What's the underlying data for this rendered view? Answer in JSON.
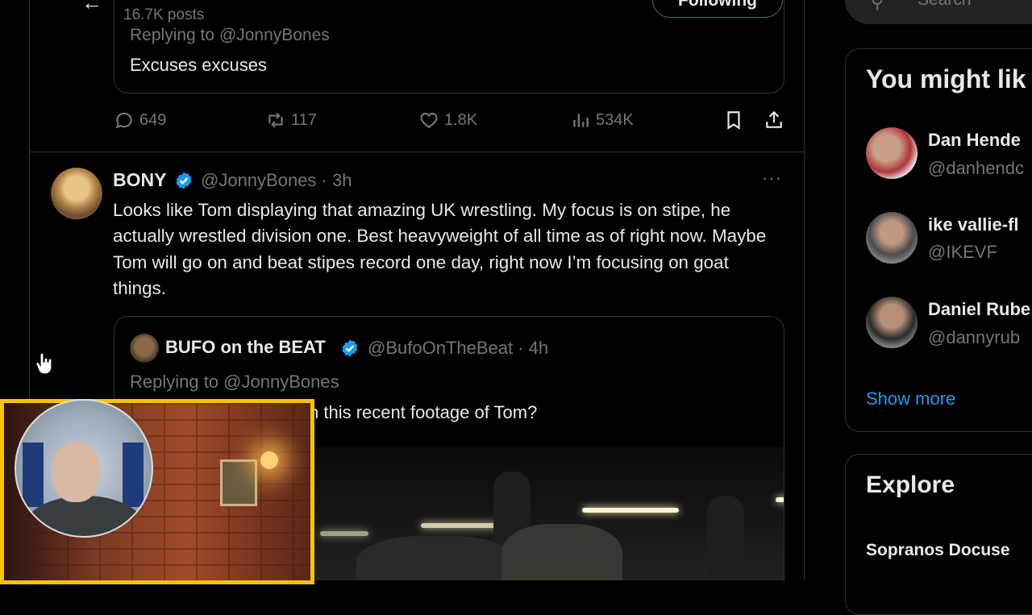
{
  "header": {
    "posts_count": "16.7K posts",
    "following_label": "Following",
    "back_glyph": "←"
  },
  "top_quote": {
    "replying_to": "Replying to @JonnyBones",
    "text": "Excuses excuses"
  },
  "actions": {
    "replies": "649",
    "reposts": "117",
    "likes": "1.8K",
    "views": "534K"
  },
  "post": {
    "name": "BONY",
    "handle_time": "@JonnyBones · 3h",
    "more": "···",
    "text": "Looks like Tom displaying that amazing UK wrestling. My focus is on stipe, he actually wrestled division one. Best heavyweight of all time as of right now. Maybe Tom will go on and beat stipes record one day, right now I’m focusing on goat things."
  },
  "quoted": {
    "name": "BUFO on the BEAT",
    "handle_time": "@BufoOnTheBeat · 4h",
    "replying_to": "Replying to @JonnyBones",
    "text_visible": "n this recent footage of Tom?"
  },
  "sidebar": {
    "search_placeholder": "Search",
    "you_might_like": "You might lik",
    "suggestions": [
      {
        "name": "Dan Hende",
        "handle": "@danhendc"
      },
      {
        "name": "ike vallie-fl",
        "handle": "@IKEVF"
      },
      {
        "name": "Daniel Rube",
        "handle": "@dannyrub"
      }
    ],
    "show_more": "Show more",
    "explore_title": "Explore",
    "trend": "Sopranos Docuse"
  },
  "colors": {
    "accent": "#1d9bf0",
    "webcam_border": "#f5c400"
  }
}
